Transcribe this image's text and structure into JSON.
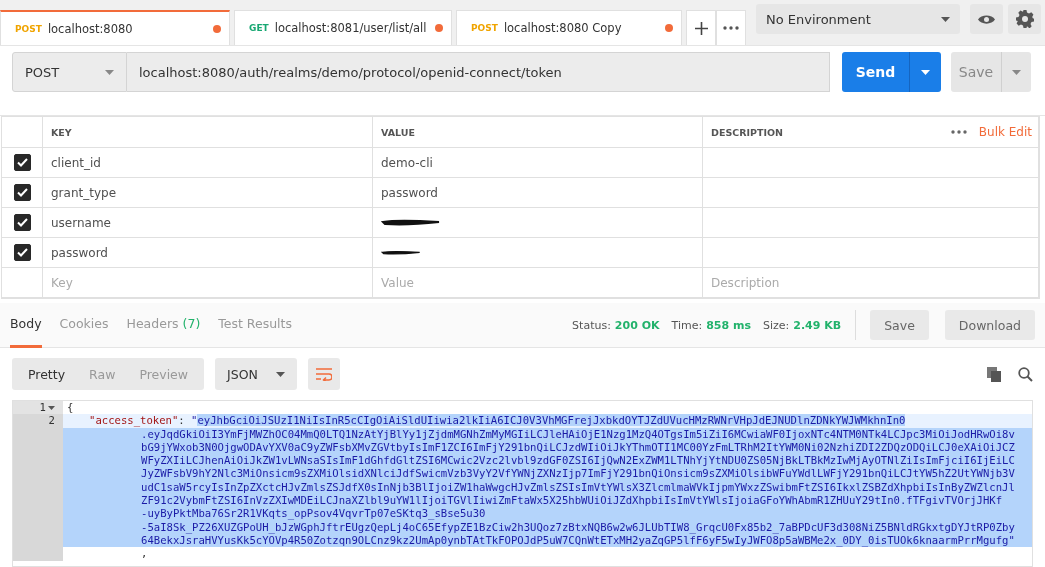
{
  "tabs": [
    {
      "method": "POST",
      "label": "localhost:8080",
      "selected": true,
      "unsaved": true
    },
    {
      "method": "GET",
      "label": "localhost:8081/user/list/all",
      "selected": false,
      "unsaved": true
    },
    {
      "method": "POST",
      "label": "localhost:8080 Copy",
      "selected": false,
      "unsaved": true
    }
  ],
  "environment": "No Environment",
  "request": {
    "method": "POST",
    "url": "localhost:8080/auth/realms/demo/protocol/openid-connect/token",
    "send": "Send",
    "save": "Save"
  },
  "params": {
    "columns": [
      "KEY",
      "VALUE",
      "DESCRIPTION"
    ],
    "bulk_edit": "Bulk Edit",
    "rows": [
      {
        "checked": true,
        "key": "client_id",
        "value": "demo-cli",
        "redacted": false
      },
      {
        "checked": true,
        "key": "grant_type",
        "value": "password",
        "redacted": false
      },
      {
        "checked": true,
        "key": "username",
        "redacted": true
      },
      {
        "checked": true,
        "key": "password",
        "redacted": true
      }
    ],
    "placeholders": {
      "key": "Key",
      "value": "Value",
      "description": "Description"
    }
  },
  "response": {
    "tabs": [
      {
        "label": "Body",
        "selected": true
      },
      {
        "label": "Cookies",
        "selected": false
      },
      {
        "label": "Headers",
        "count": "(7)",
        "selected": false
      },
      {
        "label": "Test Results",
        "selected": false
      }
    ],
    "status": [
      {
        "label": "Status:",
        "value": "200 OK"
      },
      {
        "label": "Time:",
        "value": "858 ms"
      },
      {
        "label": "Size:",
        "value": "2.49 KB"
      }
    ],
    "actions": [
      "Save",
      "Download"
    ],
    "views": [
      {
        "label": "Pretty",
        "selected": true
      },
      {
        "label": "Raw",
        "selected": false
      },
      {
        "label": "Preview",
        "selected": false
      }
    ],
    "format": "JSON",
    "code": [
      {
        "number": "1",
        "foldable": true,
        "text": "{"
      },
      {
        "number": "2",
        "foldable": false,
        "key": "\"access_token\"",
        "separator": ":",
        "open_quote": "\"",
        "token_lines": [
          "eyJhbGciOiJSUzI1NiIsInR5cCIgOiAiSldUIiwia2lkIiA6ICJ0V3VhMGFrejJxbkdOYTJZdUVucHMzRWNrVHpJdEJNUDlnZDNkYWJWMkhnIn0",
          ".eyJqdGkiOiI3YmFjMWZhOC04MmQ0LTQ1NzAtYjBlYy1jZjdmMGNhZmMyMGIiLCJleHAiOjE1Nzg1MzQ4OTgsIm5iZiI6MCwiaWF0IjoxNTc4NTM0NTk4LCJpc3MiOiJodHRwOi8v",
          "bG9jYWxob3N0OjgwODAvYXV0aC9yZWFsbXMvZGVtbyIsImF1ZCI6ImFjY291bnQiLCJzdWIiOiJkYThmOTI1MC00YzFmLTRhM2ItYWM0Ni02NzhiZDI2ZDQzODQiLCJ0eXAiOiJCZ",
          "WFyZXIiLCJhenAiOiJkZW1vLWNsaSIsImF1dGhfdGltZSI6MCwic2Vzc2lvbl9zdGF0ZSI6IjQwN2ExZWM1LTNhYjYtNDU0ZS05NjBkLTBkMzIwMjAyOTNlZiIsImFjciI6IjEiLC",
          "JyZWFsbV9hY2Nlc3MiOnsicm9sZXMiOlsidXNlciJdfSwicmVzb3VyY2VfYWNjZXNzIjp7ImFjY291bnQiOnsicm9sZXMiOlsibWFuYWdlLWFjY291bnQiLCJtYW5hZ2UtYWNjb3V",
          "udC1saW5rcyIsInZpZXctcHJvZmlsZSJdfX0sInNjb3BlIjoiZW1haWwgcHJvZmlsZSIsImVtYWlsX3ZlcmlmaWVkIjpmYWxzZSwibmFtZSI6IkxlZSBZdXhpbiIsInByZWZlcnJl",
          "ZF91c2VybmFtZSI6InVzZXIwMDEiLCJnaXZlbl9uYW1lIjoiTGVlIiwiZmFtaWx5X25hbWUiOiJZdXhpbiIsImVtYWlsIjoiaGFoYWhAbmR1ZHUuY29tIn0.fTFgivTVOrjJHKf",
          "-uyByPktMba76Sr2R1VKqts_opPsov4VqvrTp07eSKtq3_sBse5u30",
          "-5aI8Sk_PZ26XUZGPoUH_bJzWGphJftrEUgzQepLj4oC65EfypZE1BzCiw2h3UQoz7zBtxNQB6w2w6JLUbTIW8_GrqcU0Fx85b2_7aBPDcUF3d308NiZ5BNldRGkxtgDYJtRP0Zby",
          "64BekxJsraHVYusKk5cYOVp4R50Zotzqn9OLCnz9kz2UmAp0ynbTAtTkFOPOJdP5uW7CQnWtETxMH2yaZqGP5lfF6yF5wIyJWFO8p5aWBMe2x_0DY_0isTUOk6knaarmPrrMgufg\""
        ],
        "selected": true,
        "after": ","
      }
    ]
  }
}
